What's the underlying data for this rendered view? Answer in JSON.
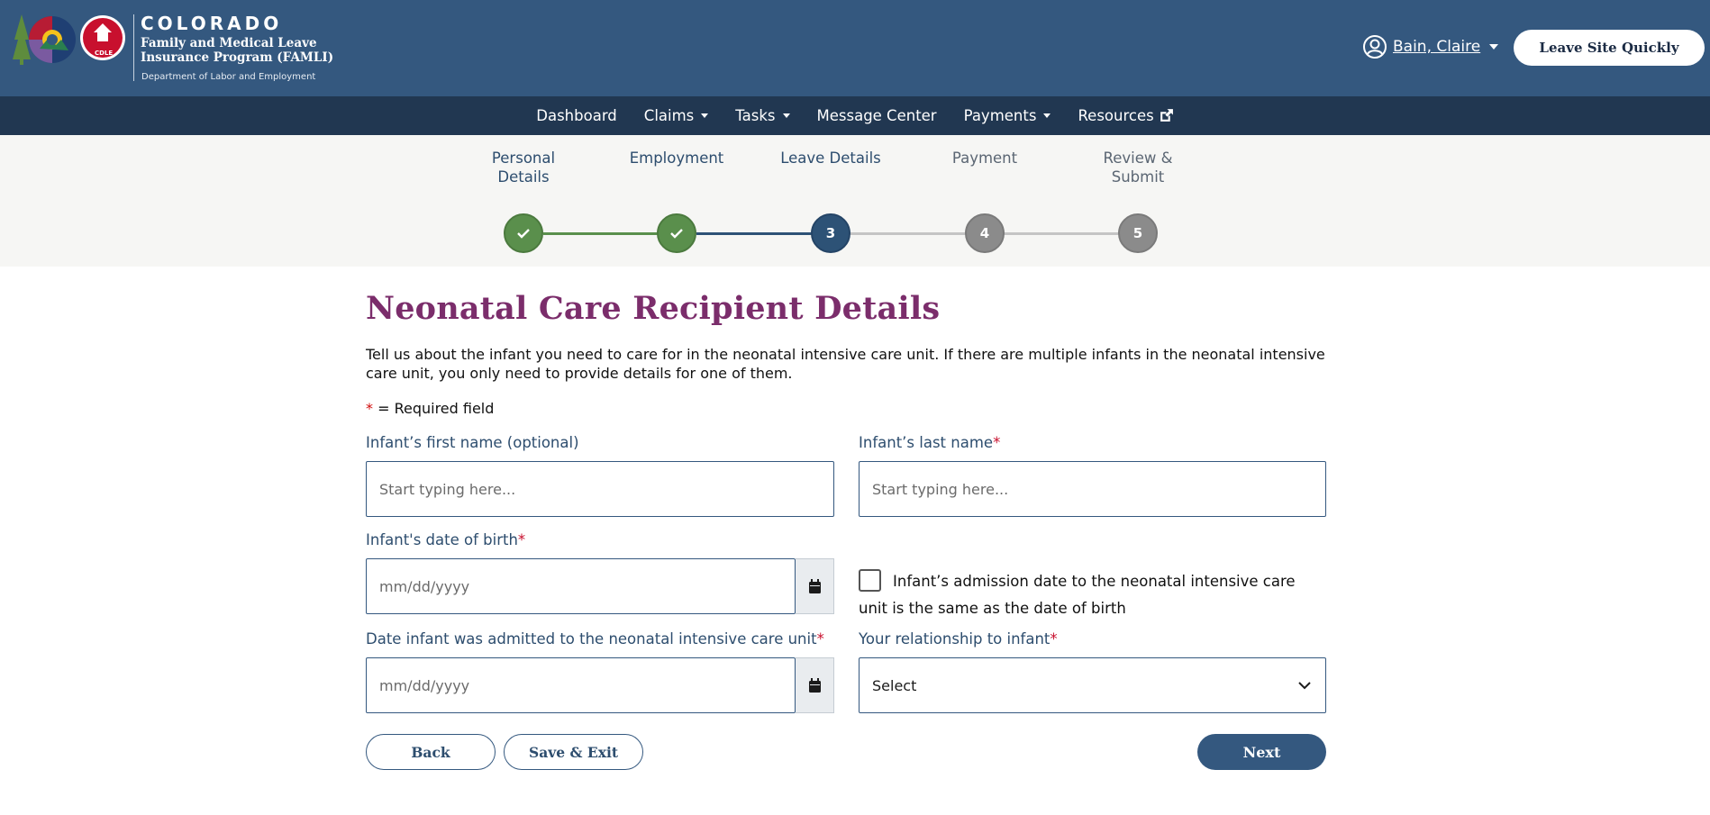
{
  "header": {
    "brand_state": "COLORADO",
    "brand_program": "Family and Medical Leave Insurance Program (FAMLI)",
    "brand_department": "Department of Labor and Employment",
    "logo_badge": "CDLE",
    "user_name": "Bain, Claire",
    "leave_site_label": "Leave Site Quickly"
  },
  "nav": {
    "items": [
      {
        "label": "Dashboard",
        "dropdown": false
      },
      {
        "label": "Claims",
        "dropdown": true
      },
      {
        "label": "Tasks",
        "dropdown": true
      },
      {
        "label": "Message Center",
        "dropdown": false
      },
      {
        "label": "Payments",
        "dropdown": true
      },
      {
        "label": "Resources",
        "dropdown": false,
        "external": true
      }
    ]
  },
  "stepper": {
    "steps": [
      {
        "line1": "Personal",
        "line2": "Details",
        "number": "1",
        "status": "done"
      },
      {
        "line1": "Employment",
        "line2": "",
        "number": "2",
        "status": "done"
      },
      {
        "line1": "Leave Details",
        "line2": "",
        "number": "3",
        "status": "active"
      },
      {
        "line1": "Payment",
        "line2": "",
        "number": "4",
        "status": "todo"
      },
      {
        "line1": "Review &",
        "line2": "Submit",
        "number": "5",
        "status": "todo"
      }
    ]
  },
  "main": {
    "title": "Neonatal Care Recipient Details",
    "intro": "Tell us about the infant you need to care for in the neonatal intensive care unit. If there are multiple infants in the neonatal intensive care unit, you only need to provide details for one of them.",
    "required_note": "= Required field",
    "required_star": "*"
  },
  "form": {
    "first_name": {
      "label": "Infant’s first name (optional)",
      "placeholder": "Start typing here...",
      "value": ""
    },
    "last_name": {
      "label": "Infant’s last name",
      "placeholder": "Start typing here...",
      "value": ""
    },
    "dob": {
      "label": "Infant's date of birth",
      "placeholder": "mm/dd/yyyy",
      "value": ""
    },
    "same_date_checkbox": {
      "label": "Infant’s admission date to the neonatal intensive care unit is the same as the date of birth",
      "checked": false
    },
    "admitted_date": {
      "label": "Date infant was admitted to the neonatal intensive care unit",
      "placeholder": "mm/dd/yyyy",
      "value": ""
    },
    "relationship": {
      "label": "Your relationship to infant",
      "selected": "Select"
    }
  },
  "actions": {
    "back_label": "Back",
    "save_exit_label": "Save & Exit",
    "next_label": "Next"
  },
  "colors": {
    "header_bg": "#34587f",
    "nav_bg": "#213751",
    "title": "#7b2d6b",
    "done": "#5a8f4c",
    "active": "#2d5276",
    "todo": "#8b8b8b"
  }
}
